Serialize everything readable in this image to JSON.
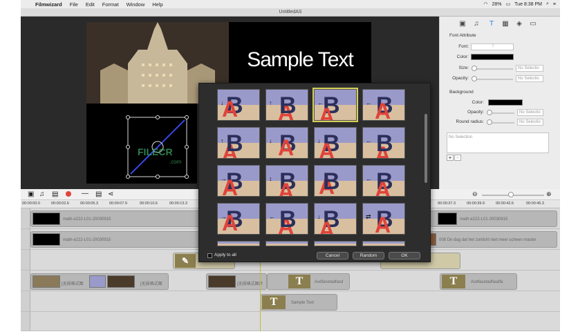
{
  "menubar": {
    "apple_icon": "apple-icon",
    "app_name": "Filmwizard",
    "items": [
      "File",
      "Edit",
      "Format",
      "Window",
      "Help"
    ],
    "battery": "28%",
    "clock": "Tue 8:38 PM"
  },
  "window": {
    "title": "UntitledAS"
  },
  "preview": {
    "sample_text": "Sample Text",
    "watermark": "FILECR",
    "watermark_sub": ".com"
  },
  "font_attribute": {
    "section_title": "Font Attribute",
    "font_label": "Font:",
    "font_value": "T",
    "color_label": "Color:",
    "size_label": "Size:",
    "size_value": "No Selectio",
    "opacity_label": "Opacity:",
    "opacity_value": "No Selectio"
  },
  "background": {
    "section_title": "Background",
    "color_label": "Color:",
    "opacity_label": "Opacity:",
    "opacity_value": "No Selectio",
    "radius_label": "Round radius:",
    "radius_value": "No Selectio"
  },
  "notes_placeholder": "No Selection",
  "ruler": {
    "ticks": [
      "00:00:00.0",
      "00:00:02.6",
      "00:00:05.3",
      "00:00:07.9",
      "00:00:10.6",
      "00:00:13.3",
      "00:00:37.3",
      "00:00:39.9",
      "00:00:42.6",
      "00:00:45.3"
    ]
  },
  "tracks": {
    "video1_label": "math-e222-L01-20030915",
    "video1_right_label": "math-e222-L01-20030915",
    "video2_label": "math-e222-L01-20030915",
    "video2_right_label": "008 De dag dat het zonlicht niet meer scheen master",
    "text_right_label": "ns",
    "img1_label": "[无损格式图",
    "img2_label": "[无损格式图",
    "img3_label": "[无损格式图片",
    "t1_label": "Asdfasetadfasd",
    "t2_label": "Asdfasetadfasdfa",
    "t3_label": "Sample Text",
    "t_glyph": "T"
  },
  "picker": {
    "apply_all": "Apply to all",
    "cancel": "Cancel",
    "random": "Random",
    "ok": "OK",
    "letter_b": "B",
    "letter_a": "A"
  }
}
